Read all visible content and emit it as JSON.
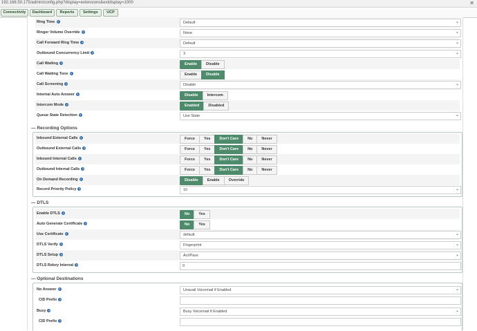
{
  "browser": {
    "url": "192.168.50.175/admin/config.php?display=extensions&extdisplay=1000",
    "close_glyph": "✕"
  },
  "nav": {
    "tabs": [
      "Connectivity",
      "Dashboard",
      "Reports",
      "Settings",
      "UCP"
    ]
  },
  "icons": {
    "help": "?",
    "chevron": "⌄",
    "collapse": "—"
  },
  "colors": {
    "accent": "#4e8a6c",
    "help": "#2e6aa8"
  },
  "general": {
    "ring_time": {
      "label": "Ring Time",
      "value": "Default"
    },
    "ringer_volume": {
      "label": "Ringer Volume Override",
      "value": "None"
    },
    "cfwd_ring_time": {
      "label": "Call Forward Ring Time",
      "value": "Default"
    },
    "outbound_concurrency": {
      "label": "Outbound Concurrency Limit",
      "value": "3"
    },
    "call_waiting": {
      "label": "Call Waiting",
      "options": [
        "Enable",
        "Disable"
      ]
    },
    "call_waiting_tone": {
      "label": "Call Waiting Tone",
      "options": [
        "Enable",
        "Disable"
      ]
    },
    "call_screening": {
      "label": "Call Screening",
      "value": "Disable"
    },
    "internal_auto_answer": {
      "label": "Internal Auto Answer",
      "options": [
        "Disable",
        "Intercom"
      ]
    },
    "intercom_mode": {
      "label": "Intercom Mode",
      "options": [
        "Enabled",
        "Disabled"
      ]
    },
    "queue_state_detection": {
      "label": "Queue State Detection",
      "value": "Use State"
    }
  },
  "recording": {
    "title": "Recording Options",
    "rec_options": [
      "Force",
      "Yes",
      "Don't Care",
      "No",
      "Never"
    ],
    "inbound_external": {
      "label": "Inbound External Calls"
    },
    "outbound_external": {
      "label": "Outbound External Calls"
    },
    "inbound_internal": {
      "label": "Inbound Internal Calls"
    },
    "outbound_internal": {
      "label": "Outbound Internal Calls"
    },
    "on_demand": {
      "label": "On Demand Recording",
      "options": [
        "Disable",
        "Enable",
        "Override"
      ]
    },
    "priority": {
      "label": "Record Priority Policy",
      "value": "10"
    }
  },
  "dtls": {
    "title": "DTLS",
    "enable": {
      "label": "Enable DTLS",
      "options": [
        "No",
        "Yes"
      ]
    },
    "auto_cert": {
      "label": "Auto Generate Certificate",
      "options": [
        "No",
        "Yes"
      ]
    },
    "use_cert": {
      "label": "Use Certificate",
      "value": "default"
    },
    "verify": {
      "label": "DTLS Verify",
      "value": "Fingerprint"
    },
    "setup": {
      "label": "DTLS Setup",
      "value": "Act/Pass"
    },
    "rekey": {
      "label": "DTLS Rekey Interval",
      "value": "0"
    }
  },
  "destinations": {
    "title": "Optional Destinations",
    "no_answer": {
      "label": "No Answer",
      "value": "Unavail Voicemail if Enabled"
    },
    "cid_prefix_label": "CID Prefix",
    "busy": {
      "label": "Busy",
      "value": "Busy Voicemail if Enabled"
    }
  }
}
